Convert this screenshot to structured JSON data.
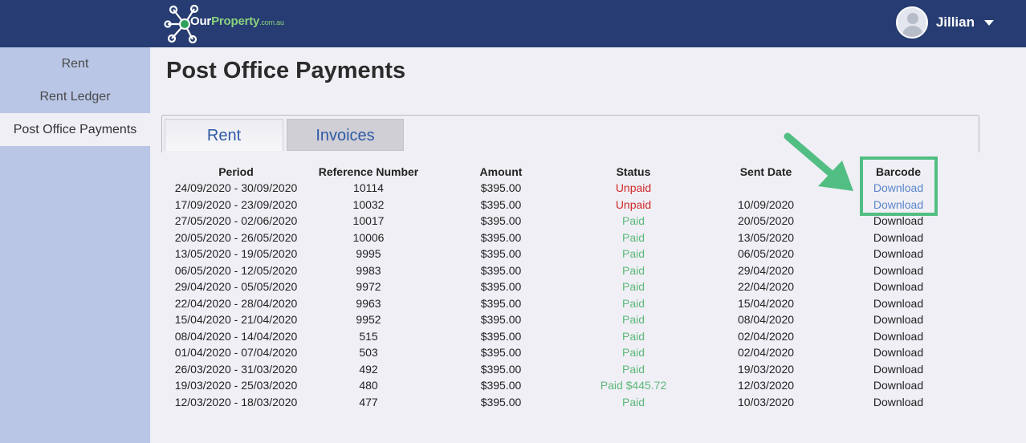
{
  "header": {
    "logo": {
      "name": "Our",
      "highlight": "Property",
      "domain": ".com.au"
    },
    "user": {
      "name": "Jillian"
    }
  },
  "sidebar": {
    "items": [
      {
        "label": "Rent"
      },
      {
        "label": "Rent Ledger"
      },
      {
        "label": "Post Office Payments"
      }
    ]
  },
  "page": {
    "title": "Post Office Payments"
  },
  "tabs": [
    {
      "label": "Rent"
    },
    {
      "label": "Invoices"
    }
  ],
  "table": {
    "headers": [
      "Period",
      "Reference Number",
      "Amount",
      "Status",
      "Sent Date",
      "Barcode"
    ],
    "rows": [
      {
        "period": "24/09/2020 - 30/09/2020",
        "ref": "10114",
        "amount": "$395.00",
        "status": "Unpaid",
        "sent": "",
        "barcode": "Download"
      },
      {
        "period": "17/09/2020 - 23/09/2020",
        "ref": "10032",
        "amount": "$395.00",
        "status": "Unpaid",
        "sent": "10/09/2020",
        "barcode": "Download"
      },
      {
        "period": "27/05/2020 - 02/06/2020",
        "ref": "10017",
        "amount": "$395.00",
        "status": "Paid",
        "sent": "20/05/2020",
        "barcode": "Download"
      },
      {
        "period": "20/05/2020 - 26/05/2020",
        "ref": "10006",
        "amount": "$395.00",
        "status": "Paid",
        "sent": "13/05/2020",
        "barcode": "Download"
      },
      {
        "period": "13/05/2020 - 19/05/2020",
        "ref": "9995",
        "amount": "$395.00",
        "status": "Paid",
        "sent": "06/05/2020",
        "barcode": "Download"
      },
      {
        "period": "06/05/2020 - 12/05/2020",
        "ref": "9983",
        "amount": "$395.00",
        "status": "Paid",
        "sent": "29/04/2020",
        "barcode": "Download"
      },
      {
        "period": "29/04/2020 - 05/05/2020",
        "ref": "9972",
        "amount": "$395.00",
        "status": "Paid",
        "sent": "22/04/2020",
        "barcode": "Download"
      },
      {
        "period": "22/04/2020 - 28/04/2020",
        "ref": "9963",
        "amount": "$395.00",
        "status": "Paid",
        "sent": "15/04/2020",
        "barcode": "Download"
      },
      {
        "period": "15/04/2020 - 21/04/2020",
        "ref": "9952",
        "amount": "$395.00",
        "status": "Paid",
        "sent": "08/04/2020",
        "barcode": "Download"
      },
      {
        "period": "08/04/2020 - 14/04/2020",
        "ref": "515",
        "amount": "$395.00",
        "status": "Paid",
        "sent": "02/04/2020",
        "barcode": "Download"
      },
      {
        "period": "01/04/2020 - 07/04/2020",
        "ref": "503",
        "amount": "$395.00",
        "status": "Paid",
        "sent": "02/04/2020",
        "barcode": "Download"
      },
      {
        "period": "26/03/2020 - 31/03/2020",
        "ref": "492",
        "amount": "$395.00",
        "status": "Paid",
        "sent": "19/03/2020",
        "barcode": "Download"
      },
      {
        "period": "19/03/2020 - 25/03/2020",
        "ref": "480",
        "amount": "$395.00",
        "status": "Paid $445.72",
        "sent": "12/03/2020",
        "barcode": "Download"
      },
      {
        "period": "12/03/2020 - 18/03/2020",
        "ref": "477",
        "amount": "$395.00",
        "status": "Paid",
        "sent": "10/03/2020",
        "barcode": "Download"
      }
    ]
  },
  "colors": {
    "header_bg": "#263c72",
    "sidebar_bg": "#b9c6e6",
    "unpaid": "#cf2a2a",
    "paid": "#5cb87a",
    "highlight": "#52be83",
    "download_link": "#5a86c9"
  }
}
